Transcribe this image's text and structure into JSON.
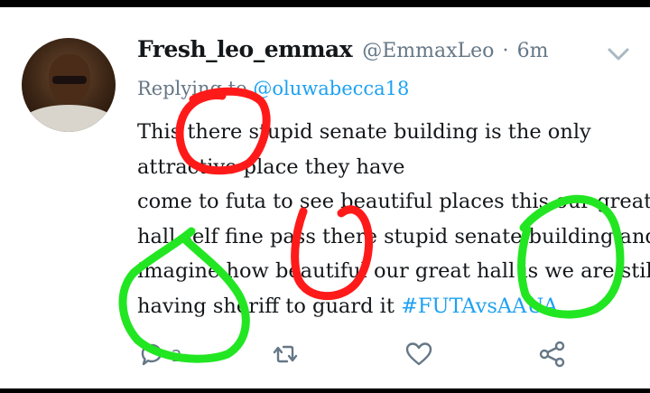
{
  "tweet": {
    "display_name": "Fresh_leo_emmax",
    "handle": "@EmmaxLeo",
    "separator": "·",
    "timestamp": "6m",
    "reply_prefix": "Replying to ",
    "reply_to": "@oluwabecca18",
    "lines": [
      "This there stupid senate building is the only",
      "attractive place they have",
      " come to futa to see beautiful places this our great",
      "hall self fine pass there stupid senate building and",
      "imagine how beautiful our great hall is we are still",
      "having sheriff to guard it "
    ],
    "hashtag": "#FUTAvsAAUA",
    "reply_count": "2"
  },
  "icons": {
    "avatar": "profile-photo",
    "menu": "chevron-down-icon",
    "reply": "reply-icon",
    "retweet": "retweet-icon",
    "like": "heart-icon",
    "share": "share-icon"
  },
  "colors": {
    "text": "#14171a",
    "muted": "#657786",
    "link": "#1da1f2",
    "red_markup": "#ff1a1a",
    "green_markup": "#22e622"
  }
}
